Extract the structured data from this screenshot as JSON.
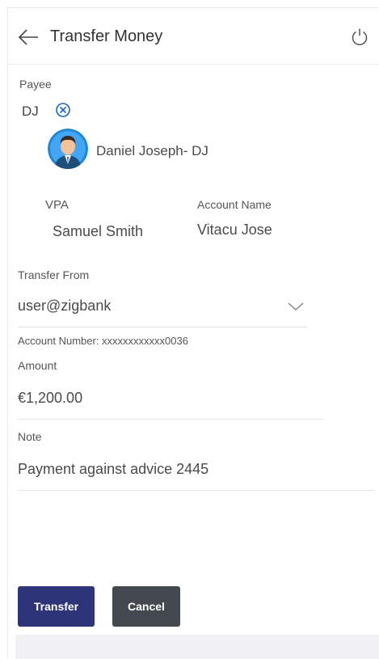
{
  "header": {
    "title": "Transfer Money",
    "back_icon": "arrow-left-icon",
    "logout_icon": "power-icon"
  },
  "payee": {
    "label": "Payee",
    "chip": "DJ",
    "remove_icon": "circle-x-icon",
    "avatar_icon": "person-avatar-icon",
    "name": "Daniel Joseph",
    "nickname_suffix": "- DJ",
    "vpa_label": "VPA",
    "vpa_value": "Samuel Smith",
    "account_name_label": "Account Name",
    "account_name_value": "Vitacu Jose"
  },
  "transfer_from": {
    "label": "Transfer From",
    "selected": "user@zigbank",
    "dropdown_icon": "chevron-down-icon",
    "account_number_text": "Account Number: xxxxxxxxxxxx0036"
  },
  "amount": {
    "label": "Amount",
    "value": "€1,200.00"
  },
  "note": {
    "label": "Note",
    "value": "Payment against advice 2445"
  },
  "actions": {
    "transfer_label": "Transfer",
    "cancel_label": "Cancel"
  },
  "colors": {
    "primary": "#2e3478",
    "secondary": "#444950",
    "accent_icon": "#1565c0"
  }
}
